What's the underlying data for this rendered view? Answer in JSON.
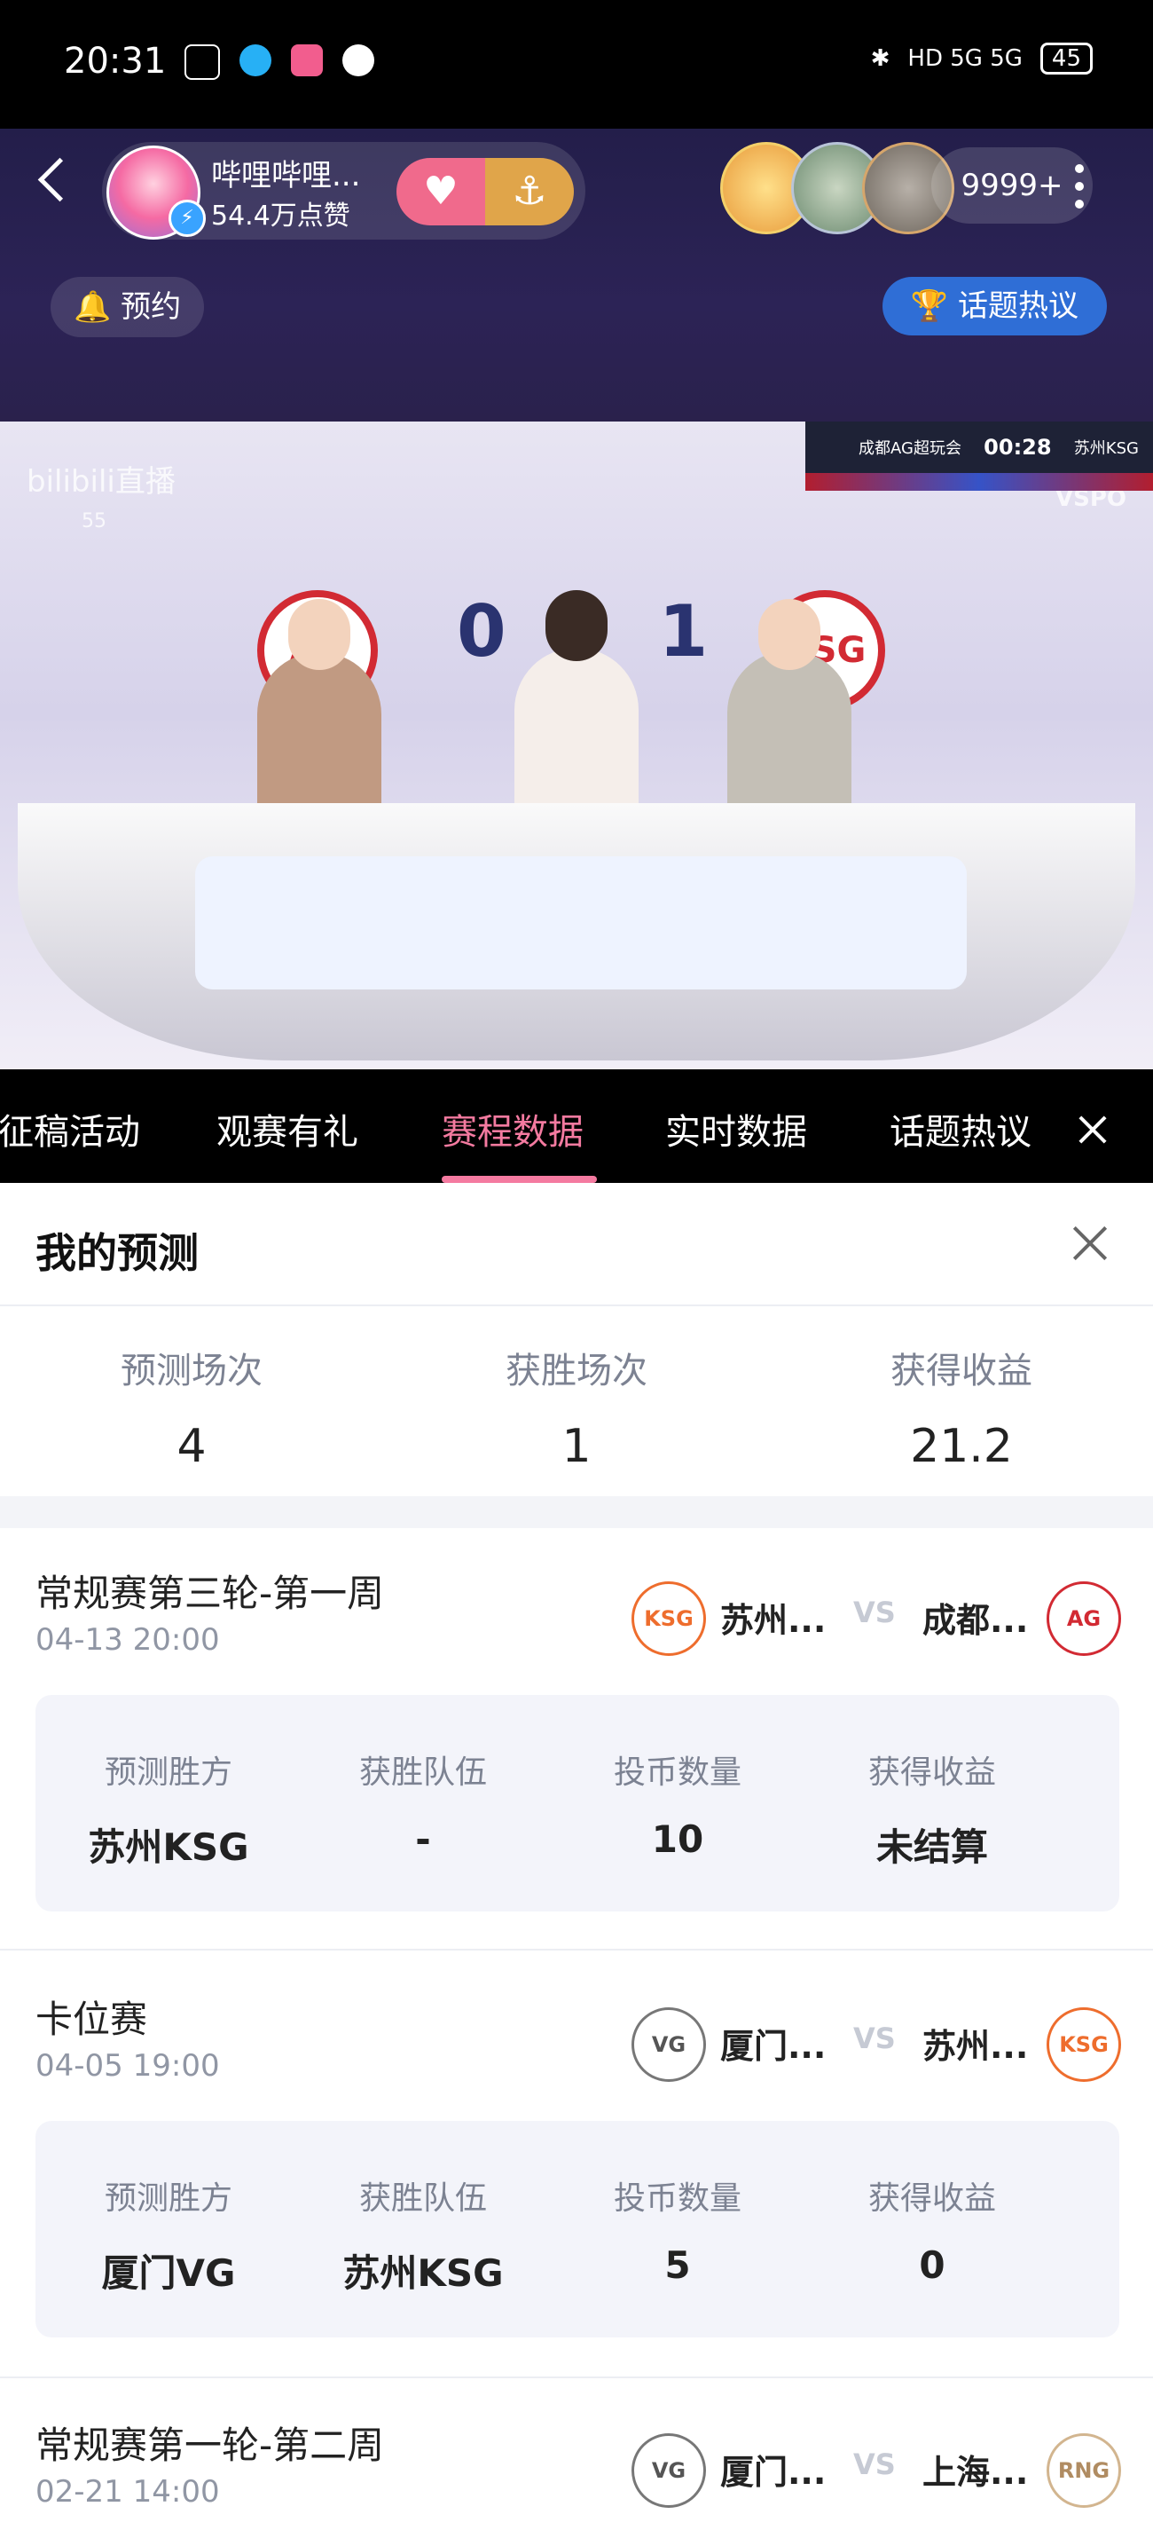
{
  "status_bar": {
    "time": "20:31",
    "network": "HD 5G 5G",
    "battery": "45"
  },
  "live_header": {
    "host_name": "哔哩哔哩...",
    "host_likes": "54.4万点赞",
    "viewer_count": "9999+",
    "reserve_label": "预约",
    "topic_button": "话题热议"
  },
  "video": {
    "brand": "bilibili直播",
    "brand_num": "55",
    "vspo": "VSPO",
    "ticker_left": "成都AG超玩会",
    "ticker_time": "00:28",
    "ticker_right": "苏州KSG",
    "score": "0:1",
    "logo_left": "AG",
    "logo_right": "KSG"
  },
  "tabs": [
    {
      "label": "征稿活动",
      "active": false
    },
    {
      "label": "观赛有礼",
      "active": false
    },
    {
      "label": "赛程数据",
      "active": true
    },
    {
      "label": "实时数据",
      "active": false
    },
    {
      "label": "话题热议",
      "active": false
    }
  ],
  "prediction": {
    "title": "我的预测",
    "stats": [
      {
        "label": "预测场次",
        "value": "4"
      },
      {
        "label": "获胜场次",
        "value": "1"
      },
      {
        "label": "获得收益",
        "value": "21.2"
      }
    ],
    "matches": [
      {
        "title": "常规赛第三轮-第一周",
        "time": "04-13 20:00",
        "team1": "苏州...",
        "team1_logo": "KSG",
        "team2": "成都...",
        "team2_logo": "AG",
        "vs": "VS",
        "details": [
          {
            "label": "预测胜方",
            "value": "苏州KSG"
          },
          {
            "label": "获胜队伍",
            "value": "-"
          },
          {
            "label": "投币数量",
            "value": "10"
          },
          {
            "label": "获得收益",
            "value": "未结算"
          }
        ]
      },
      {
        "title": "卡位赛",
        "time": "04-05 19:00",
        "team1": "厦门...",
        "team1_logo": "VG",
        "team2": "苏州...",
        "team2_logo": "KSG",
        "vs": "VS",
        "details": [
          {
            "label": "预测胜方",
            "value": "厦门VG"
          },
          {
            "label": "获胜队伍",
            "value": "苏州KSG"
          },
          {
            "label": "投币数量",
            "value": "5"
          },
          {
            "label": "获得收益",
            "value": "0"
          }
        ]
      },
      {
        "title": "常规赛第一轮-第二周",
        "time": "02-21 14:00",
        "team1": "厦门...",
        "team1_logo": "VG",
        "team2": "上海...",
        "team2_logo": "RNG",
        "vs": "VS"
      }
    ]
  },
  "colors": {
    "accent_pink": "#f47aa0",
    "topic_blue": "#2f6ed6",
    "header_bg": "#231e4a"
  }
}
